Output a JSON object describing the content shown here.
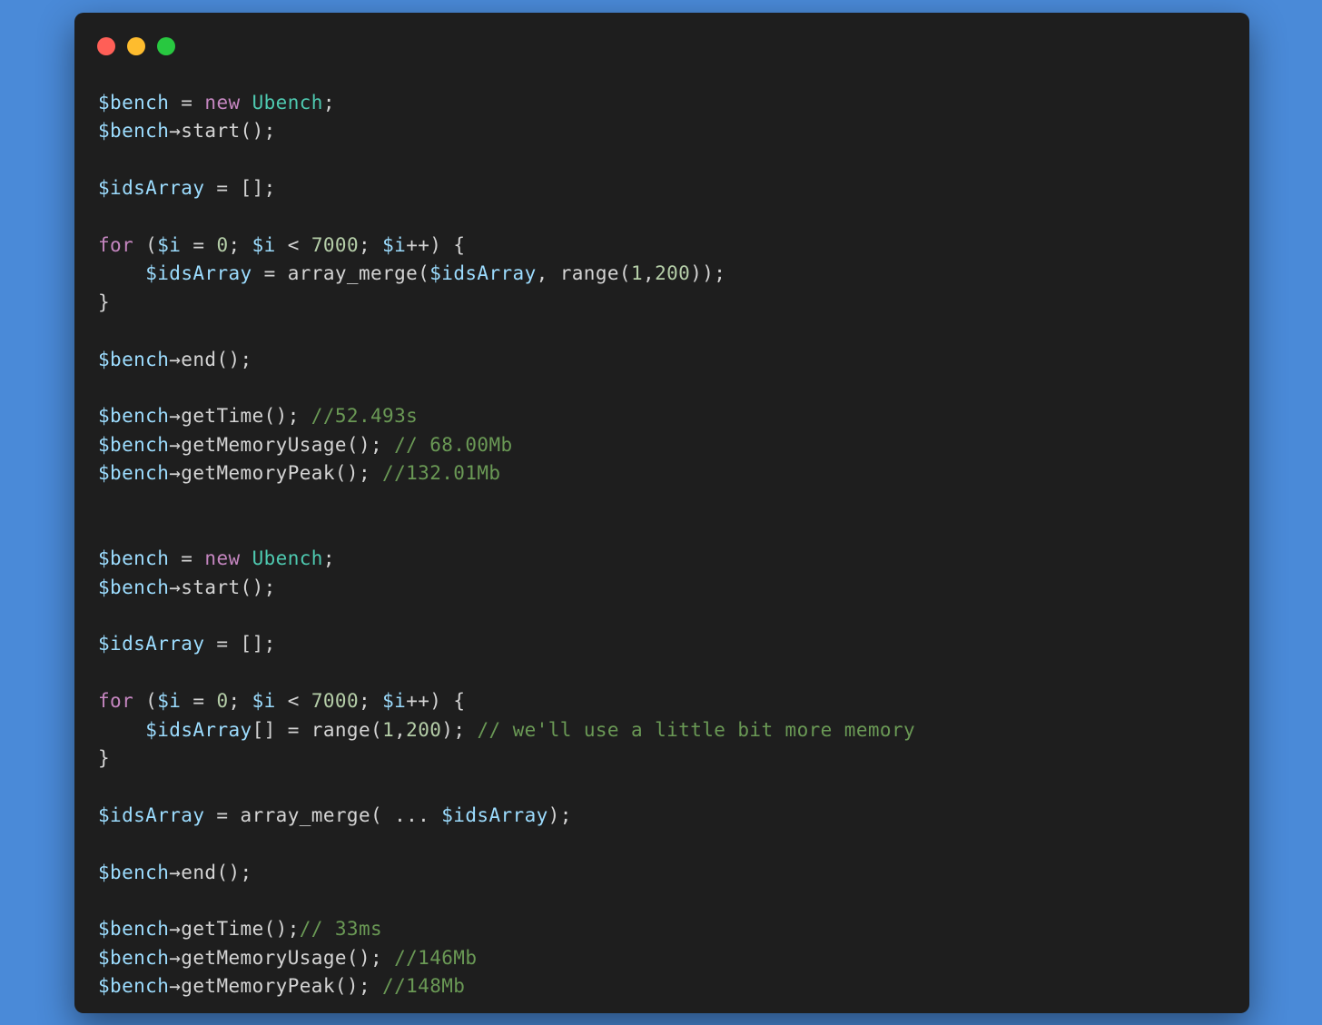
{
  "window": {
    "controls": [
      {
        "name": "close-dot",
        "color": "#ff5f57"
      },
      {
        "name": "minimize-dot",
        "color": "#febc2e"
      },
      {
        "name": "zoom-dot",
        "color": "#28c840"
      }
    ]
  },
  "colors": {
    "background": "#4a8ad8",
    "editor": "#1e1e1e",
    "variable": "#9cdcfe",
    "keyword": "#c586c0",
    "class": "#4ec9b0",
    "number": "#b5cea8",
    "comment": "#6a9955",
    "text": "#d4d4d4"
  },
  "code": {
    "lines": [
      [
        {
          "t": "var",
          "v": "$bench"
        },
        {
          "t": "plain",
          "v": " = "
        },
        {
          "t": "kw",
          "v": "new"
        },
        {
          "t": "plain",
          "v": " "
        },
        {
          "t": "cls",
          "v": "Ubench"
        },
        {
          "t": "plain",
          "v": ";"
        }
      ],
      [
        {
          "t": "var",
          "v": "$bench"
        },
        {
          "t": "plain",
          "v": "→start();"
        }
      ],
      [],
      [
        {
          "t": "var",
          "v": "$idsArray"
        },
        {
          "t": "plain",
          "v": " = [];"
        }
      ],
      [],
      [
        {
          "t": "kw",
          "v": "for"
        },
        {
          "t": "plain",
          "v": " ("
        },
        {
          "t": "var",
          "v": "$i"
        },
        {
          "t": "plain",
          "v": " = "
        },
        {
          "t": "num",
          "v": "0"
        },
        {
          "t": "plain",
          "v": "; "
        },
        {
          "t": "var",
          "v": "$i"
        },
        {
          "t": "plain",
          "v": " < "
        },
        {
          "t": "num",
          "v": "7000"
        },
        {
          "t": "plain",
          "v": "; "
        },
        {
          "t": "var",
          "v": "$i"
        },
        {
          "t": "plain",
          "v": "++) {"
        }
      ],
      [
        {
          "t": "plain",
          "v": "    "
        },
        {
          "t": "var",
          "v": "$idsArray"
        },
        {
          "t": "plain",
          "v": " = array_merge("
        },
        {
          "t": "var",
          "v": "$idsArray"
        },
        {
          "t": "plain",
          "v": ", range("
        },
        {
          "t": "num",
          "v": "1"
        },
        {
          "t": "plain",
          "v": ","
        },
        {
          "t": "num",
          "v": "200"
        },
        {
          "t": "plain",
          "v": "));"
        }
      ],
      [
        {
          "t": "plain",
          "v": "}"
        }
      ],
      [],
      [
        {
          "t": "var",
          "v": "$bench"
        },
        {
          "t": "plain",
          "v": "→end();"
        }
      ],
      [],
      [
        {
          "t": "var",
          "v": "$bench"
        },
        {
          "t": "plain",
          "v": "→getTime(); "
        },
        {
          "t": "cmt",
          "v": "//52.493s"
        }
      ],
      [
        {
          "t": "var",
          "v": "$bench"
        },
        {
          "t": "plain",
          "v": "→getMemoryUsage(); "
        },
        {
          "t": "cmt",
          "v": "// 68.00Mb"
        }
      ],
      [
        {
          "t": "var",
          "v": "$bench"
        },
        {
          "t": "plain",
          "v": "→getMemoryPeak(); "
        },
        {
          "t": "cmt",
          "v": "//132.01Mb"
        }
      ],
      [],
      [],
      [
        {
          "t": "var",
          "v": "$bench"
        },
        {
          "t": "plain",
          "v": " = "
        },
        {
          "t": "kw",
          "v": "new"
        },
        {
          "t": "plain",
          "v": " "
        },
        {
          "t": "cls",
          "v": "Ubench"
        },
        {
          "t": "plain",
          "v": ";"
        }
      ],
      [
        {
          "t": "var",
          "v": "$bench"
        },
        {
          "t": "plain",
          "v": "→start();"
        }
      ],
      [],
      [
        {
          "t": "var",
          "v": "$idsArray"
        },
        {
          "t": "plain",
          "v": " = [];"
        }
      ],
      [],
      [
        {
          "t": "kw",
          "v": "for"
        },
        {
          "t": "plain",
          "v": " ("
        },
        {
          "t": "var",
          "v": "$i"
        },
        {
          "t": "plain",
          "v": " = "
        },
        {
          "t": "num",
          "v": "0"
        },
        {
          "t": "plain",
          "v": "; "
        },
        {
          "t": "var",
          "v": "$i"
        },
        {
          "t": "plain",
          "v": " < "
        },
        {
          "t": "num",
          "v": "7000"
        },
        {
          "t": "plain",
          "v": "; "
        },
        {
          "t": "var",
          "v": "$i"
        },
        {
          "t": "plain",
          "v": "++) {"
        }
      ],
      [
        {
          "t": "plain",
          "v": "    "
        },
        {
          "t": "var",
          "v": "$idsArray"
        },
        {
          "t": "plain",
          "v": "[] = range("
        },
        {
          "t": "num",
          "v": "1"
        },
        {
          "t": "plain",
          "v": ","
        },
        {
          "t": "num",
          "v": "200"
        },
        {
          "t": "plain",
          "v": "); "
        },
        {
          "t": "cmt",
          "v": "// we'll use a little bit more memory"
        }
      ],
      [
        {
          "t": "plain",
          "v": "}"
        }
      ],
      [],
      [
        {
          "t": "var",
          "v": "$idsArray"
        },
        {
          "t": "plain",
          "v": " = array_merge( ... "
        },
        {
          "t": "var",
          "v": "$idsArray"
        },
        {
          "t": "plain",
          "v": ");"
        }
      ],
      [],
      [
        {
          "t": "var",
          "v": "$bench"
        },
        {
          "t": "plain",
          "v": "→end();"
        }
      ],
      [],
      [
        {
          "t": "var",
          "v": "$bench"
        },
        {
          "t": "plain",
          "v": "→getTime();"
        },
        {
          "t": "cmt",
          "v": "// 33ms"
        }
      ],
      [
        {
          "t": "var",
          "v": "$bench"
        },
        {
          "t": "plain",
          "v": "→getMemoryUsage(); "
        },
        {
          "t": "cmt",
          "v": "//146Mb"
        }
      ],
      [
        {
          "t": "var",
          "v": "$bench"
        },
        {
          "t": "plain",
          "v": "→getMemoryPeak(); "
        },
        {
          "t": "cmt",
          "v": "//148Mb"
        }
      ]
    ]
  }
}
